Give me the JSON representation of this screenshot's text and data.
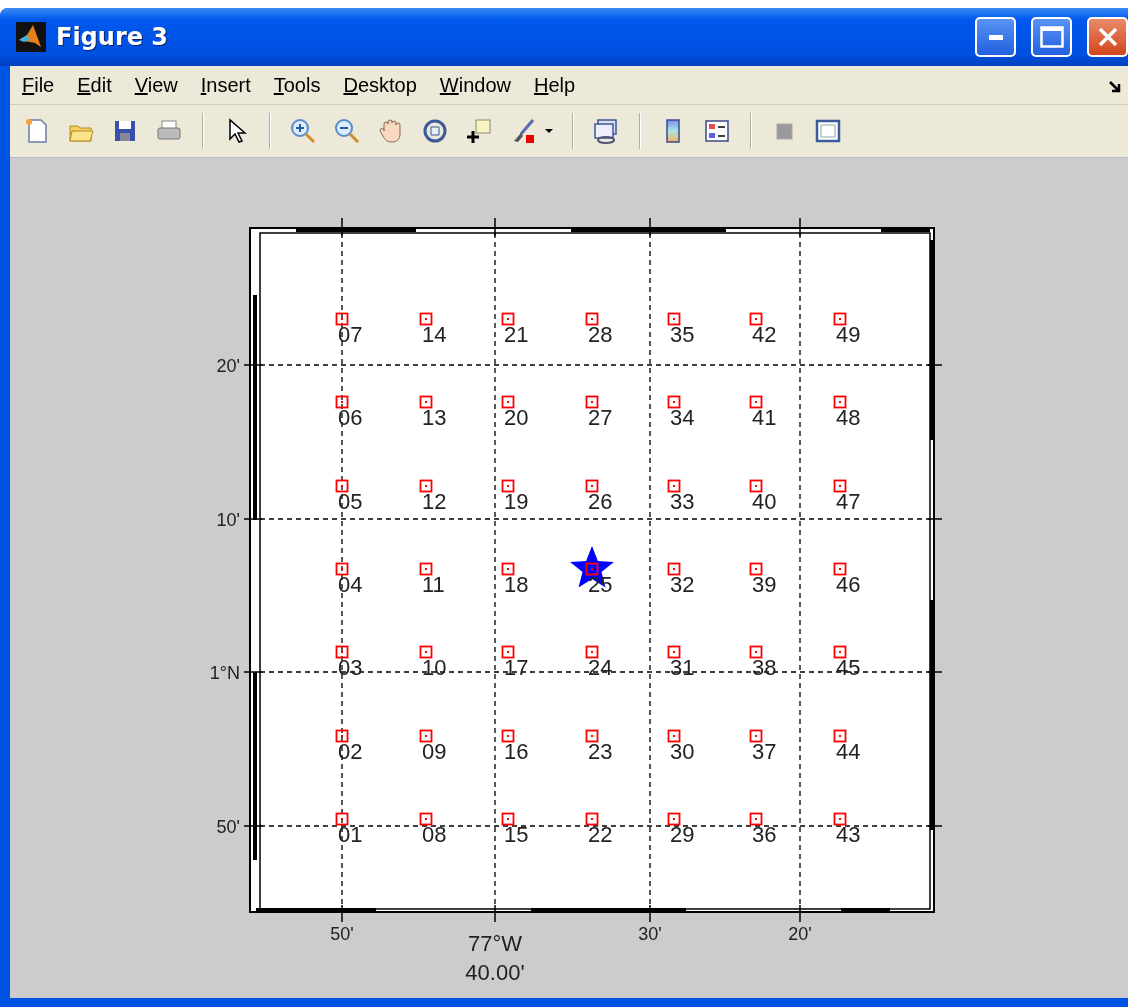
{
  "window": {
    "title": "Figure 3"
  },
  "menu": [
    {
      "label": "File"
    },
    {
      "label": "Edit"
    },
    {
      "label": "View"
    },
    {
      "label": "Insert"
    },
    {
      "label": "Tools"
    },
    {
      "label": "Desktop"
    },
    {
      "label": "Window"
    },
    {
      "label": "Help"
    }
  ],
  "map": {
    "x_ticks": [
      "50'",
      "77°W",
      "30'",
      "20'"
    ],
    "x_sublabel": "40.00'",
    "y_ticks": [
      "20'",
      "10'",
      "1°N",
      "50'"
    ],
    "columns": [
      [
        {
          "label": "07",
          "starred": false
        },
        {
          "label": "06",
          "starred": false
        },
        {
          "label": "05",
          "starred": false
        },
        {
          "label": "04",
          "starred": false
        },
        {
          "label": "03",
          "starred": false
        },
        {
          "label": "02",
          "starred": false
        },
        {
          "label": "01",
          "starred": false
        }
      ],
      [
        {
          "label": "14",
          "starred": false
        },
        {
          "label": "13",
          "starred": false
        },
        {
          "label": "12",
          "starred": false
        },
        {
          "label": "11",
          "starred": false
        },
        {
          "label": "10",
          "starred": false
        },
        {
          "label": "09",
          "starred": false
        },
        {
          "label": "08",
          "starred": false
        }
      ],
      [
        {
          "label": "21",
          "starred": false
        },
        {
          "label": "20",
          "starred": false
        },
        {
          "label": "19",
          "starred": false
        },
        {
          "label": "18",
          "starred": false
        },
        {
          "label": "17",
          "starred": false
        },
        {
          "label": "16",
          "starred": false
        },
        {
          "label": "15",
          "starred": false
        }
      ],
      [
        {
          "label": "28",
          "starred": false
        },
        {
          "label": "27",
          "starred": false
        },
        {
          "label": "26",
          "starred": false
        },
        {
          "label": "25",
          "starred": true
        },
        {
          "label": "24",
          "starred": false
        },
        {
          "label": "23",
          "starred": false
        },
        {
          "label": "22",
          "starred": false
        }
      ],
      [
        {
          "label": "35",
          "starred": false
        },
        {
          "label": "34",
          "starred": false
        },
        {
          "label": "33",
          "starred": false
        },
        {
          "label": "32",
          "starred": false
        },
        {
          "label": "31",
          "starred": false
        },
        {
          "label": "30",
          "starred": false
        },
        {
          "label": "29",
          "starred": false
        }
      ],
      [
        {
          "label": "42",
          "starred": false
        },
        {
          "label": "41",
          "starred": false
        },
        {
          "label": "40",
          "starred": false
        },
        {
          "label": "39",
          "starred": false
        },
        {
          "label": "38",
          "starred": false
        },
        {
          "label": "37",
          "starred": false
        },
        {
          "label": "36",
          "starred": false
        }
      ],
      [
        {
          "label": "49",
          "starred": false
        },
        {
          "label": "48",
          "starred": false
        },
        {
          "label": "47",
          "starred": false
        },
        {
          "label": "46",
          "starred": false
        },
        {
          "label": "45",
          "starred": false
        },
        {
          "label": "44",
          "starred": false
        },
        {
          "label": "43",
          "starred": false
        }
      ]
    ]
  }
}
